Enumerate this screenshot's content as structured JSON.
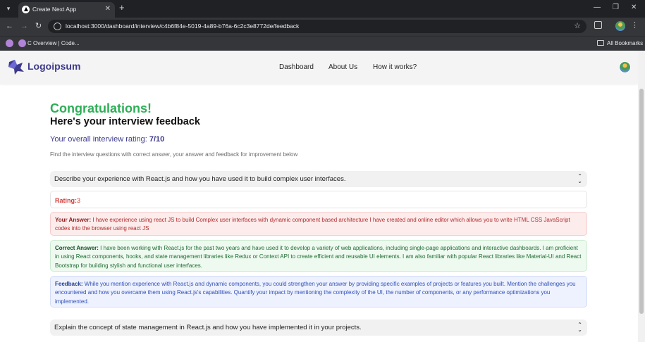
{
  "browser": {
    "tab_title": "Create Next App",
    "url": "localhost:3000/dashboard/interview/c4b6f84e-5019-4a89-b76a-6c2c3e8772de/feedback",
    "bookmark_label": "C Overview | Code...",
    "all_bookmarks": "All Bookmarks"
  },
  "header": {
    "logo_text": "Logoipsum",
    "nav": [
      "Dashboard",
      "About Us",
      "How it works?"
    ]
  },
  "feedback": {
    "congrats": "Congratulations!",
    "subtitle": "Here's your interview feedback",
    "rating_prefix": "Your overall interview rating: ",
    "overall_rating": "7/10",
    "hint": "Find the interview questions with correct answer, your answer and feedback for improvement below"
  },
  "questions": [
    {
      "question": "Describe your experience with React.js and how you have used it to build complex user interfaces.",
      "rating_label": "Rating:",
      "rating": "3",
      "answer_label": "Your Answer:",
      "answer": " I have experience using react JS to build Complex user interfaces with dynamic component based architecture I have created and online editor which allows you to write HTML CSS JavaScript codes into the browser using react JS",
      "correct_label": "Correct Answer:",
      "correct": " I have been working with React.js for the past two years and have used it to develop a variety of web applications, including single-page applications and interactive dashboards. I am proficient in using React components, hooks, and state management libraries like Redux or Context API to create efficient and reusable UI elements. I am also familiar with popular React libraries like Material-UI and React Bootstrap for building stylish and functional user interfaces.",
      "feedback_label": "Feedback:",
      "feedback": " While you mention experience with React.js and dynamic components, you could strengthen your answer by providing specific examples of projects or features you built. Mention the challenges you encountered and how you overcame them using React.js's capabilities. Quantify your impact by mentioning the complexity of the UI, the number of components, or any performance optimizations you implemented."
    },
    {
      "question": "Explain the concept of state management in React.js and how you have implemented it in your projects."
    }
  ],
  "colors": {
    "brand": "#3d3a8c",
    "success": "#2eae57",
    "error": "#d23b3b"
  }
}
